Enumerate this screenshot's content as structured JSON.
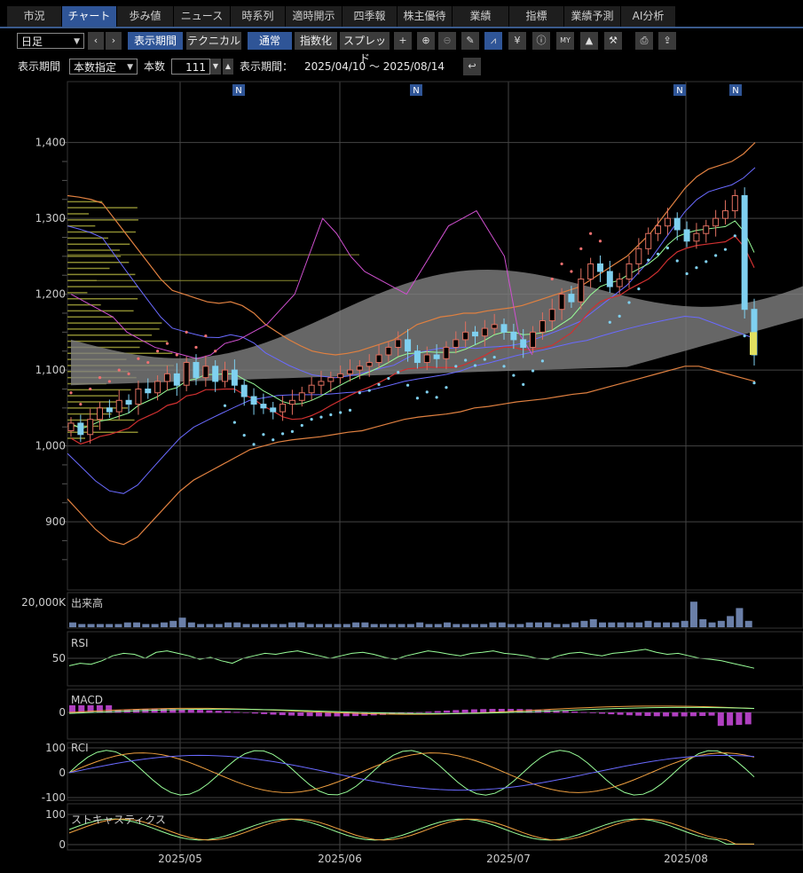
{
  "tabs": [
    "市況",
    "チャート",
    "歩み値",
    "ニュース",
    "時系列",
    "適時開示",
    "四季報",
    "株主優待",
    "業績",
    "指標",
    "業績予測",
    "AI分析"
  ],
  "active_tab": 1,
  "toolbar": {
    "interval": "日足",
    "display_period_button": "表示期間",
    "technical_button": "テクニカル",
    "normal_button": "通常",
    "index_button": "指数化",
    "spread_button": "スプレッド",
    "icons": [
      "crosshair-icon",
      "zoom-in-icon",
      "zoom-out-icon",
      "pencil-icon",
      "chart-type-icon",
      "yen-icon",
      "info-icon",
      "my-icon",
      "area-chart-icon",
      "wrench-icon",
      "print-icon",
      "export-icon"
    ]
  },
  "period_row": {
    "label": "表示期間",
    "mode": "本数指定",
    "count_label": "本数",
    "count": "111",
    "range_label": "表示期間：",
    "range": "2025/04/10 〜 2025/08/14"
  },
  "colors": {
    "accent": "#2f5597",
    "up": "#e07060",
    "down": "#7fd0f0",
    "cloud": "#808080"
  },
  "chart_data": {
    "type": "candlestick",
    "x_ticks": [
      "2025/05",
      "2025/06",
      "2025/07",
      "2025/08"
    ],
    "price_axis": {
      "ticks": [
        900,
        1000,
        1100,
        1200,
        1300,
        1400
      ],
      "labels": [
        "900",
        "1,000",
        "1,100",
        "1,200",
        "1,300",
        "1,400"
      ],
      "ylim": [
        810,
        1430
      ]
    },
    "news_markers": [
      "N",
      "N",
      "N",
      "N"
    ],
    "price_close": [
      1030,
      1015,
      1035,
      1050,
      1045,
      1060,
      1055,
      1075,
      1070,
      1085,
      1095,
      1080,
      1110,
      1090,
      1105,
      1085,
      1100,
      1080,
      1065,
      1055,
      1050,
      1045,
      1055,
      1060,
      1070,
      1080,
      1085,
      1090,
      1095,
      1100,
      1105,
      1110,
      1120,
      1130,
      1140,
      1125,
      1110,
      1120,
      1115,
      1130,
      1140,
      1150,
      1145,
      1155,
      1160,
      1150,
      1140,
      1130,
      1150,
      1165,
      1180,
      1200,
      1190,
      1220,
      1240,
      1230,
      1210,
      1220,
      1240,
      1260,
      1280,
      1290,
      1300,
      1285,
      1270,
      1280,
      1290,
      1300,
      1310,
      1330,
      1180,
      1120
    ],
    "price_upper_band": [
      1330,
      1328,
      1325,
      1320,
      1300,
      1280,
      1260,
      1240,
      1220,
      1205,
      1200,
      1195,
      1190,
      1188,
      1190,
      1185,
      1175,
      1160,
      1150,
      1140,
      1132,
      1125,
      1122,
      1120,
      1122,
      1125,
      1130,
      1135,
      1140,
      1150,
      1160,
      1165,
      1170,
      1172,
      1175,
      1175,
      1178,
      1180,
      1182,
      1185,
      1190,
      1195,
      1200,
      1205,
      1210,
      1220,
      1230,
      1240,
      1250,
      1265,
      1280,
      1300,
      1320,
      1340,
      1355,
      1365,
      1370,
      1375,
      1385,
      1400
    ],
    "price_lower_band": [
      930,
      910,
      890,
      875,
      870,
      880,
      900,
      920,
      940,
      955,
      965,
      975,
      985,
      995,
      1000,
      1005,
      1008,
      1010,
      1012,
      1015,
      1018,
      1020,
      1025,
      1030,
      1035,
      1038,
      1040,
      1042,
      1045,
      1050,
      1052,
      1055,
      1058,
      1060,
      1062,
      1065,
      1068,
      1070,
      1075,
      1080,
      1085,
      1090,
      1095,
      1100,
      1105,
      1105,
      1100,
      1095,
      1090,
      1085
    ],
    "volume": {
      "label": "出来高",
      "axis_label": "20,000K",
      "values": [
        3,
        2,
        2,
        2,
        2,
        2,
        3,
        3,
        2,
        2,
        3,
        4,
        6,
        3,
        2,
        2,
        2,
        3,
        3,
        2,
        2,
        2,
        2,
        2,
        3,
        3,
        2,
        2,
        2,
        2,
        2,
        3,
        3,
        2,
        2,
        2,
        2,
        2,
        3,
        2,
        2,
        3,
        2,
        2,
        2,
        2,
        3,
        3,
        2,
        2,
        3,
        3,
        3,
        2,
        2,
        3,
        4,
        5,
        3,
        3,
        3,
        3,
        3,
        4,
        3,
        3,
        3,
        4,
        16,
        5,
        3,
        4,
        7,
        12,
        4
      ]
    },
    "rsi": {
      "label": "RSI",
      "ticks": [
        "50"
      ],
      "values": [
        35,
        40,
        38,
        45,
        55,
        60,
        58,
        50,
        62,
        65,
        60,
        55,
        48,
        52,
        45,
        40,
        50,
        55,
        60,
        58,
        62,
        65,
        60,
        55,
        50,
        55,
        60,
        62,
        58,
        52,
        48,
        55,
        60,
        65,
        62,
        58,
        55,
        60,
        62,
        65,
        60,
        58,
        55,
        50,
        48,
        55,
        60,
        62,
        58,
        55,
        60,
        62,
        65,
        68,
        62,
        58,
        60,
        55,
        50,
        48,
        45,
        40,
        35,
        30
      ]
    },
    "macd": {
      "label": "MACD",
      "ticks": [
        "0"
      ]
    },
    "rci": {
      "label": "RCI",
      "ticks": [
        "100",
        "0",
        "-100"
      ]
    },
    "stochastics": {
      "label": "ストキャスティクス",
      "ticks": [
        "100",
        "0"
      ]
    }
  }
}
